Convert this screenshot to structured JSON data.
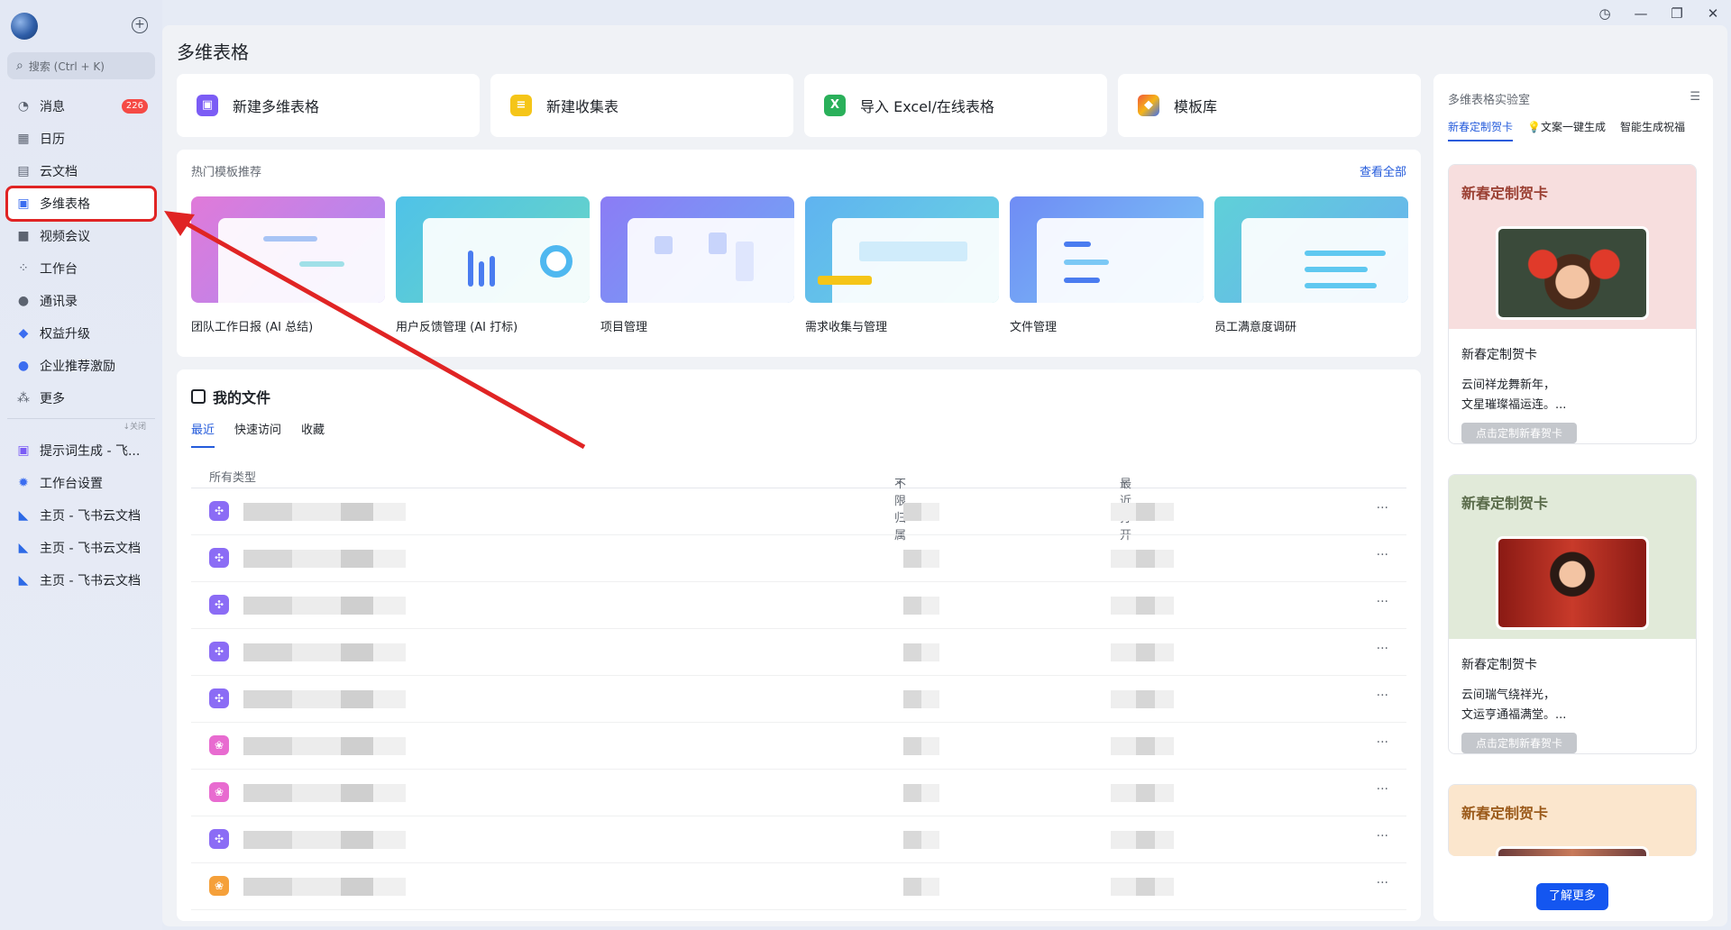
{
  "window": {
    "history_icon": "clock-icon",
    "min": "—",
    "restore": "❐",
    "close": "✕"
  },
  "sidebar": {
    "search_placeholder": "搜索 (Ctrl + K)",
    "items": [
      {
        "label": "消息",
        "icon": "message-icon",
        "badge": "226"
      },
      {
        "label": "日历",
        "icon": "calendar-icon"
      },
      {
        "label": "云文档",
        "icon": "docs-icon"
      },
      {
        "label": "多维表格",
        "icon": "base-icon"
      },
      {
        "label": "视频会议",
        "icon": "video-icon"
      },
      {
        "label": "工作台",
        "icon": "grid-icon"
      },
      {
        "label": "通讯录",
        "icon": "contacts-icon"
      },
      {
        "label": "权益升级",
        "icon": "diamond-icon"
      },
      {
        "label": "企业推荐激励",
        "icon": "person-icon"
      },
      {
        "label": "更多",
        "icon": "more-icon"
      }
    ],
    "collapse_label": "↓关闭",
    "pinned": [
      {
        "label": "提示词生成 - 飞...",
        "icon": "base-icon"
      },
      {
        "label": "工作台设置",
        "icon": "gear-icon"
      },
      {
        "label": "主页 - 飞书云文档",
        "icon": "feishu-icon"
      },
      {
        "label": "主页 - 飞书云文档",
        "icon": "feishu-icon"
      },
      {
        "label": "主页 - 飞书云文档",
        "icon": "feishu-icon"
      }
    ]
  },
  "main": {
    "title": "多维表格",
    "quick_actions": [
      {
        "label": "新建多维表格",
        "icon": "base-icon",
        "color": "#7b5cf5"
      },
      {
        "label": "新建收集表",
        "icon": "form-icon",
        "color": "#f5c518"
      },
      {
        "label": "导入 Excel/在线表格",
        "icon": "excel-icon",
        "color": "#2ab05a"
      },
      {
        "label": "模板库",
        "icon": "template-icon",
        "color": "#f0583a"
      }
    ],
    "templates": {
      "heading": "热门模板推荐",
      "view_all": "查看全部",
      "items": [
        {
          "label": "团队工作日报 (AI 总结)"
        },
        {
          "label": "用户反馈管理 (AI 打标)"
        },
        {
          "label": "项目管理"
        },
        {
          "label": "需求收集与管理"
        },
        {
          "label": "文件管理"
        },
        {
          "label": "员工满意度调研"
        }
      ]
    },
    "files": {
      "title": "我的文件",
      "tabs": [
        "最近",
        "快速访问",
        "收藏"
      ],
      "col_type": "所有类型",
      "col_owner": "不限归属",
      "col_time": "最近打开",
      "more": "···"
    }
  },
  "right_panel": {
    "title": "多维表格实验室",
    "tabs": [
      "新春定制贺卡",
      "文案一键生成",
      "智能生成祝福"
    ],
    "cards": [
      {
        "banner": "新春定制贺卡",
        "title": "新春定制贺卡",
        "line1": "云间祥龙舞新年，",
        "line2": "文星璀璨福运连。...",
        "button": "点击定制新春贺卡"
      },
      {
        "banner": "新春定制贺卡",
        "title": "新春定制贺卡",
        "line1": "云间瑞气绕祥光，",
        "line2": "文运亨通福满堂。...",
        "button": "点击定制新春贺卡"
      },
      {
        "banner": "新春定制贺卡"
      }
    ],
    "learn_more": "了解更多"
  }
}
